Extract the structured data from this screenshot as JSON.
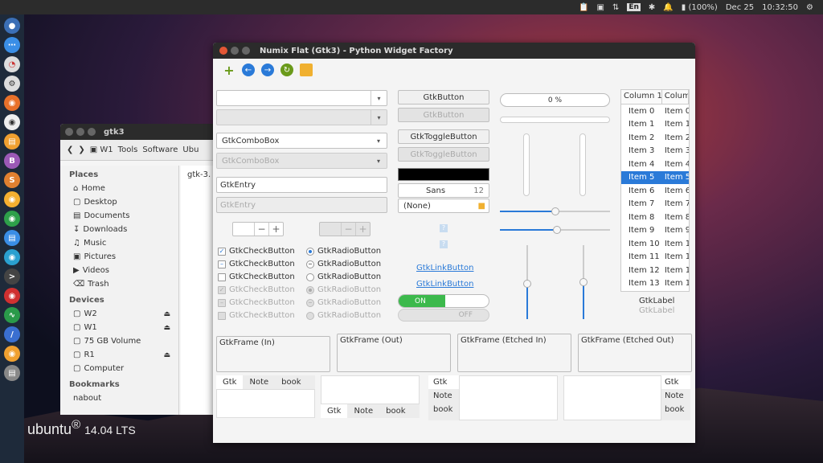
{
  "panel": {
    "battery": "(100%)",
    "date": "Dec 25",
    "time": "10:32:50",
    "lang": "En"
  },
  "desktop": {
    "distro": "ubuntu",
    "version": "14.04 LTS"
  },
  "nautilus": {
    "title": "gtk3",
    "toolbar": [
      "W1",
      "Tools",
      "Software",
      "Ubu"
    ],
    "places_header": "Places",
    "places": [
      "Home",
      "Desktop",
      "Documents",
      "Downloads",
      "Music",
      "Pictures",
      "Videos",
      "Trash"
    ],
    "devices_header": "Devices",
    "devices": [
      "W2",
      "W1",
      "75 GB Volume",
      "R1",
      "Computer"
    ],
    "bookmarks_header": "Bookmarks",
    "bookmark_partial": "nabout",
    "file": "gtk-3."
  },
  "window": {
    "title": "Numix Flat (Gtk3) - Python Widget Factory"
  },
  "col1": {
    "combo_empty": "",
    "combo1": "GtkComboBox",
    "combo2": "GtkComboBox",
    "entry1": "GtkEntry",
    "entry2": "GtkEntry",
    "checks": [
      "GtkCheckButton",
      "GtkCheckButton",
      "GtkCheckButton",
      "GtkCheckButton",
      "GtkCheckButton",
      "GtkCheckButton"
    ],
    "radios": [
      "GtkRadioButton",
      "GtkRadioButton",
      "GtkRadioButton",
      "GtkRadioButton",
      "GtkRadioButton",
      "GtkRadioButton"
    ]
  },
  "col2": {
    "button1": "GtkButton",
    "button2": "GtkButton",
    "toggle1": "GtkToggleButton",
    "toggle2": "GtkToggleButton",
    "font": "Sans",
    "font_size": "12",
    "file": "(None)",
    "link1": "GtkLinkButton",
    "link2": "GtkLinkButton",
    "on": "ON",
    "off": "OFF"
  },
  "col3": {
    "progress": "0 %",
    "progress_value": 0,
    "hscale1": 0.5,
    "hscale2": 0.52,
    "vscale1": 0.48,
    "vscale2": 0.5
  },
  "tree": {
    "headers": [
      "Column 1",
      "Column"
    ],
    "rows": [
      "Item 0",
      "Item 1",
      "Item 2",
      "Item 3",
      "Item 4",
      "Item 5",
      "Item 6",
      "Item 7",
      "Item 8",
      "Item 9",
      "Item 10",
      "Item 11",
      "Item 12",
      "Item 13"
    ],
    "rows2": [
      "Item 0",
      "Item 1",
      "Item 2",
      "Item 3",
      "Item 4",
      "Item 5",
      "Item 6",
      "Item 7",
      "Item 8",
      "Item 9",
      "Item 1",
      "Item 1",
      "Item 1",
      "Item 1"
    ],
    "selected": 5,
    "label1": "GtkLabel",
    "label2": "GtkLabel"
  },
  "frames": [
    "GtkFrame (In)",
    "GtkFrame (Out)",
    "GtkFrame (Etched In)",
    "GtkFrame (Etched Out)"
  ],
  "tabs": [
    "Gtk",
    "Note",
    "book"
  ]
}
